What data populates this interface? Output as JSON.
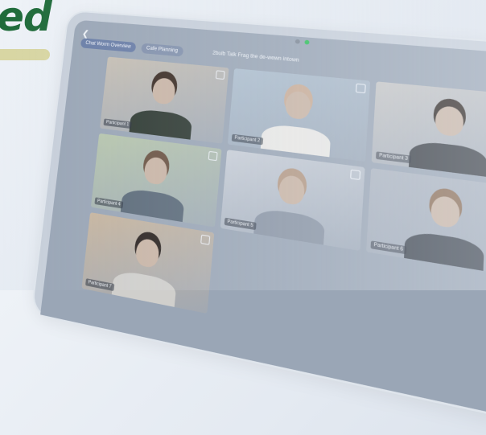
{
  "hero": {
    "headline": "ed"
  },
  "meeting": {
    "back_icon": "chevron-left-icon",
    "pills": [
      "Chat Worm Overview",
      "Cafe Planning"
    ],
    "title": "2bulb Talk Frag the de-wewn intown",
    "more_icon": "more-vertical-icon",
    "participants": [
      {
        "name": "Participant 1",
        "hair": "#3b2c24",
        "shirt": "#2f3a33",
        "bg": "#c6bfb4"
      },
      {
        "name": "Participant 2",
        "hair": "#c9ad98",
        "shirt": "#e9e8e6",
        "bg": "#aebfcf"
      },
      {
        "name": "Participant 3",
        "hair": "#2e2622",
        "shirt": "#3a3f46",
        "bg": "#c7c7c7"
      },
      {
        "name": "Participant 4",
        "hair": "#6b5343",
        "shirt": "#5c6b7a",
        "bg": "#b7c6ad"
      },
      {
        "name": "Participant 5",
        "hair": "#b49a86",
        "shirt": "#8b96a6",
        "bg": "#c9cfd8"
      },
      {
        "name": "Participant 6",
        "hair": "#8b6d55",
        "shirt": "#3f4752",
        "bg": "#aeb6c2"
      },
      {
        "name": "Participant 7",
        "hair": "#2b2421",
        "shirt": "#d0cfcc",
        "bg": "#c7b59f"
      }
    ]
  },
  "colors": {
    "brand_green": "#1f6b3a",
    "highlight": "#d8d6a3",
    "camera_on": "#2fbf5a"
  }
}
